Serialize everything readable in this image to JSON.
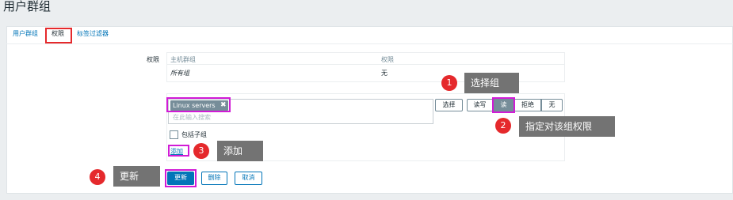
{
  "page": {
    "title": "用户群组"
  },
  "tabs": [
    {
      "label": "用户群组"
    },
    {
      "label": "权限"
    },
    {
      "label": "标签过滤器"
    }
  ],
  "form": {
    "permissions_label": "权限",
    "table": {
      "col_hostgroup": "主机群组",
      "col_permission": "权限",
      "row_hostgroup": "所有组",
      "row_permission": "无"
    },
    "selector": {
      "chip_label": "Linux servers",
      "chip_remove": "✖",
      "placeholder": "在此输入搜索",
      "select_button": "选择"
    },
    "permission_options": [
      "读写",
      "读",
      "拒绝",
      "无"
    ],
    "selected_permission": "读",
    "include_subgroups_label": "包括子组",
    "add_link": "添加",
    "buttons": {
      "update": "更新",
      "delete": "删除",
      "cancel": "取消"
    }
  },
  "annotations": [
    {
      "number": "1",
      "text": "选择组"
    },
    {
      "number": "2",
      "text": "指定对该组权限"
    },
    {
      "number": "3",
      "text": "添加"
    },
    {
      "number": "4",
      "text": "更新"
    }
  ],
  "colors": {
    "accent": "#0275b8",
    "tab_highlight": "#e5292c",
    "step_highlight": "#d11bd6",
    "marker": "#e5292c",
    "callout_bg": "#737373"
  }
}
